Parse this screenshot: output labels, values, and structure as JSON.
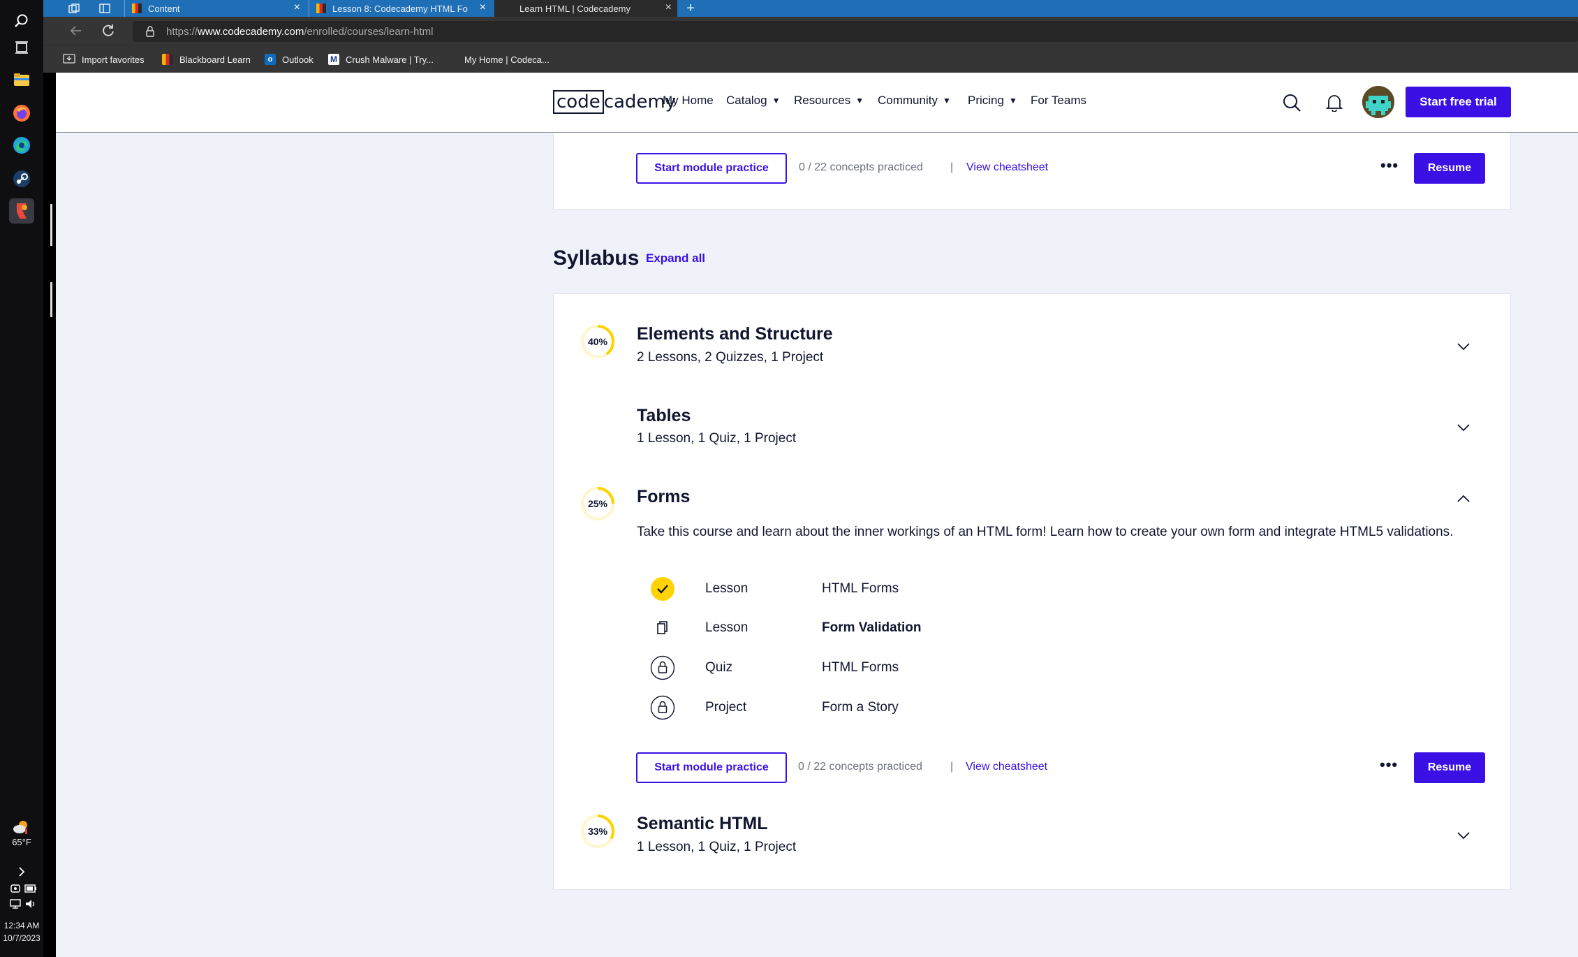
{
  "taskbar": {
    "weather_temp": "65°F",
    "clock_time": "12:34 AM",
    "clock_date": "10/7/2023"
  },
  "browser": {
    "tabs": [
      {
        "label": "Content"
      },
      {
        "label": "Lesson 8: Codecademy HTML Fo"
      },
      {
        "label": "Learn HTML | Codecademy"
      }
    ],
    "url_prefix": "https://",
    "url_host": "www.codecademy.com",
    "url_path": "/enrolled/courses/learn-html",
    "bookmarks": [
      {
        "label": "Import favorites"
      },
      {
        "label": "Blackboard Learn"
      },
      {
        "label": "Outlook"
      },
      {
        "label": "Crush Malware | Try..."
      },
      {
        "label": "My Home | Codeca..."
      }
    ]
  },
  "header": {
    "logo_left": "code",
    "logo_right": "cademy",
    "nav": [
      {
        "label": "My Home"
      },
      {
        "label": "Catalog"
      },
      {
        "label": "Resources"
      },
      {
        "label": "Community"
      },
      {
        "label": "Pricing"
      },
      {
        "label": "For Teams"
      }
    ],
    "trial_button": "Start free trial"
  },
  "top_card": {
    "practice_button": "Start module practice",
    "concepts": "0 / 22 concepts practiced",
    "separator": "|",
    "cheatsheet": "View cheatsheet",
    "more": "•••",
    "resume": "Resume"
  },
  "syllabus": {
    "title": "Syllabus",
    "expand_all": "Expand all",
    "modules": [
      {
        "progress_label": "40%",
        "progress": 0.4,
        "title": "Elements and Structure",
        "subtitle": "2 Lessons, 2 Quizzes, 1 Project"
      },
      {
        "progress_label": "",
        "progress": 0,
        "title": "Tables",
        "subtitle": "1 Lesson, 1 Quiz, 1 Project"
      },
      {
        "progress_label": "25%",
        "progress": 0.25,
        "title": "Forms",
        "subtitle": "",
        "description": "Take this course and learn about the inner workings of an HTML form! Learn how to create your own form and integrate HTML5 validations."
      },
      {
        "progress_label": "33%",
        "progress": 0.33,
        "title": "Semantic HTML",
        "subtitle": "1 Lesson, 1 Quiz, 1 Project"
      }
    ],
    "forms_items": [
      {
        "type": "Lesson",
        "title": "HTML Forms",
        "status": "completed",
        "icon": "check-icon"
      },
      {
        "type": "Lesson",
        "title": "Form Validation",
        "status": "current",
        "icon": "document-icon"
      },
      {
        "type": "Quiz",
        "title": "HTML Forms",
        "status": "locked",
        "icon": "lock-icon"
      },
      {
        "type": "Project",
        "title": "Form a Story",
        "status": "locked",
        "icon": "lock-icon"
      }
    ],
    "forms_footer": {
      "practice_button": "Start module practice",
      "concepts": "0 / 22 concepts practiced",
      "separator": "|",
      "cheatsheet": "View cheatsheet",
      "more": "•••",
      "resume": "Resume"
    }
  },
  "colors": {
    "accent": "#3a10e5",
    "progress_ring": "#ffd300",
    "text": "#10162f",
    "page_bg": "#eff2f8"
  }
}
